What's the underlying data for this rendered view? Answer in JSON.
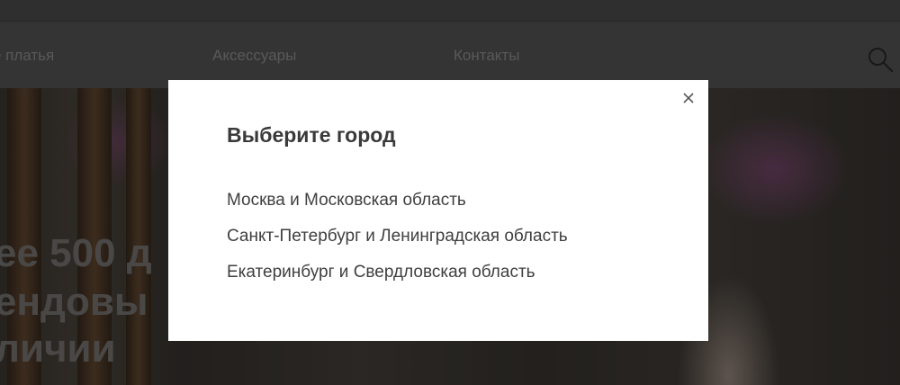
{
  "nav": {
    "items": [
      {
        "label": "е платья"
      },
      {
        "label": "Аксессуары"
      },
      {
        "label": "Контакты"
      }
    ],
    "search_icon": "search-icon"
  },
  "hero": {
    "lines": [
      "ее 500 д",
      "ендовы",
      "личии"
    ]
  },
  "modal": {
    "title": "Выберите город",
    "close_icon": "close-icon",
    "cities": [
      {
        "label": "Москва и Московская область"
      },
      {
        "label": "Санкт-Петербург и Ленинградская область"
      },
      {
        "label": "Екатеринбург и Свердловская область"
      }
    ]
  },
  "colors": {
    "navbar_bg": "#404040",
    "nav_text": "#6d6d6d",
    "modal_bg": "#ffffff",
    "modal_text": "#3f3f3f"
  }
}
